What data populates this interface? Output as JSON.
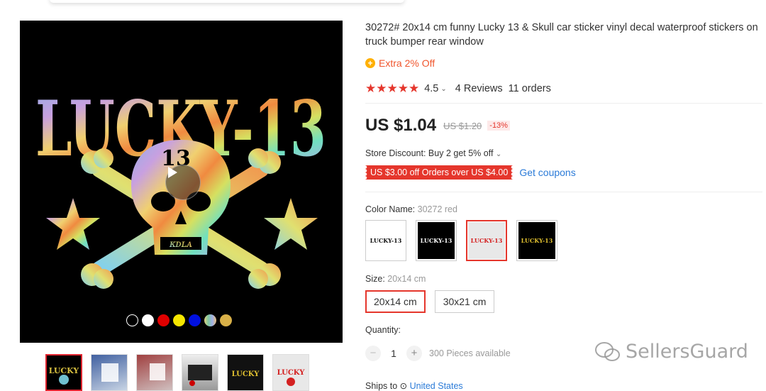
{
  "product": {
    "title": "30272# 20x14 cm funny Lucky 13 & Skull car sticker vinyl decal waterproof stickers on truck bumper rear window",
    "extra_discount": "Extra 2% Off",
    "rating_value": "4.5",
    "reviews": "4 Reviews",
    "orders": "11 orders",
    "price": "US $1.04",
    "old_price": "US $1.20",
    "discount_badge": "-13%",
    "store_discount": "Store Discount: Buy 2 get 5% off",
    "coupon": "US $3.00 off Orders over US $4.00",
    "get_coupons": "Get coupons",
    "color_label": "Color Name:",
    "color_value": "30272 red",
    "size_label": "Size:",
    "size_value": "20x14 cm",
    "sizes": [
      "20x14 cm",
      "30x21 cm"
    ],
    "quantity_label": "Quantity:",
    "quantity": "1",
    "available": "300 Pieces available",
    "ship_label": "Ships to",
    "ship_country": "United States"
  },
  "gallery": {
    "sticker_text": "LUCKY-13",
    "skull_number": "13",
    "color_dots": [
      "#000000",
      "#ffffff",
      "#e00000",
      "#f5e600",
      "#0010e0",
      "#9fc8e8",
      "#d8b048"
    ]
  },
  "swatches": [
    {
      "text": "LUCKY-13",
      "bg": "#ffffff",
      "fg": "#111111"
    },
    {
      "text": "LUCKY-13",
      "bg": "#000000",
      "fg": "#ffffff"
    },
    {
      "text": "LUCKY-13",
      "bg": "#e8e8e8",
      "fg": "#d42020"
    },
    {
      "text": "LUCKY-13",
      "bg": "#000000",
      "fg": "#e0c030"
    }
  ],
  "watermark": "SellersGuard",
  "colors": {
    "accent": "#e5362c",
    "link": "#2b7bd8",
    "extra": "#f0552c"
  }
}
